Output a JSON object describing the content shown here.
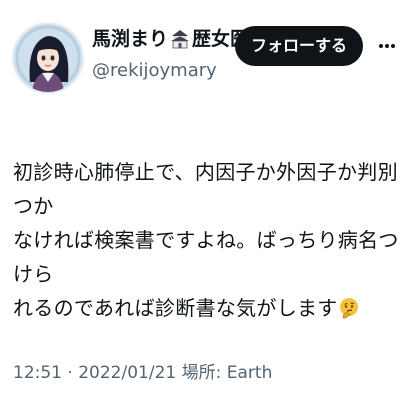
{
  "user": {
    "name_part1": "馬渕まり",
    "name_part2": "歴女医",
    "castle_icon": "castle-icon",
    "handle": "@rekijoymary",
    "avatar": "anime-style-portrait-avatar"
  },
  "actions": {
    "follow_label": "フォローする",
    "more_icon": "more-horizontal-icon"
  },
  "tweet": {
    "line1": "初診時心肺停止で、内因子か外因子か判別つか",
    "line2": "なければ検案書ですよね。ばっちり病名つけら",
    "line3": "れるのであれば診断書な気がします",
    "emoji": "thinking-face-emoji"
  },
  "meta": {
    "time": "12:51",
    "separator": "·",
    "date": "2022/01/21",
    "location_label": "場所:",
    "location": "Earth"
  }
}
